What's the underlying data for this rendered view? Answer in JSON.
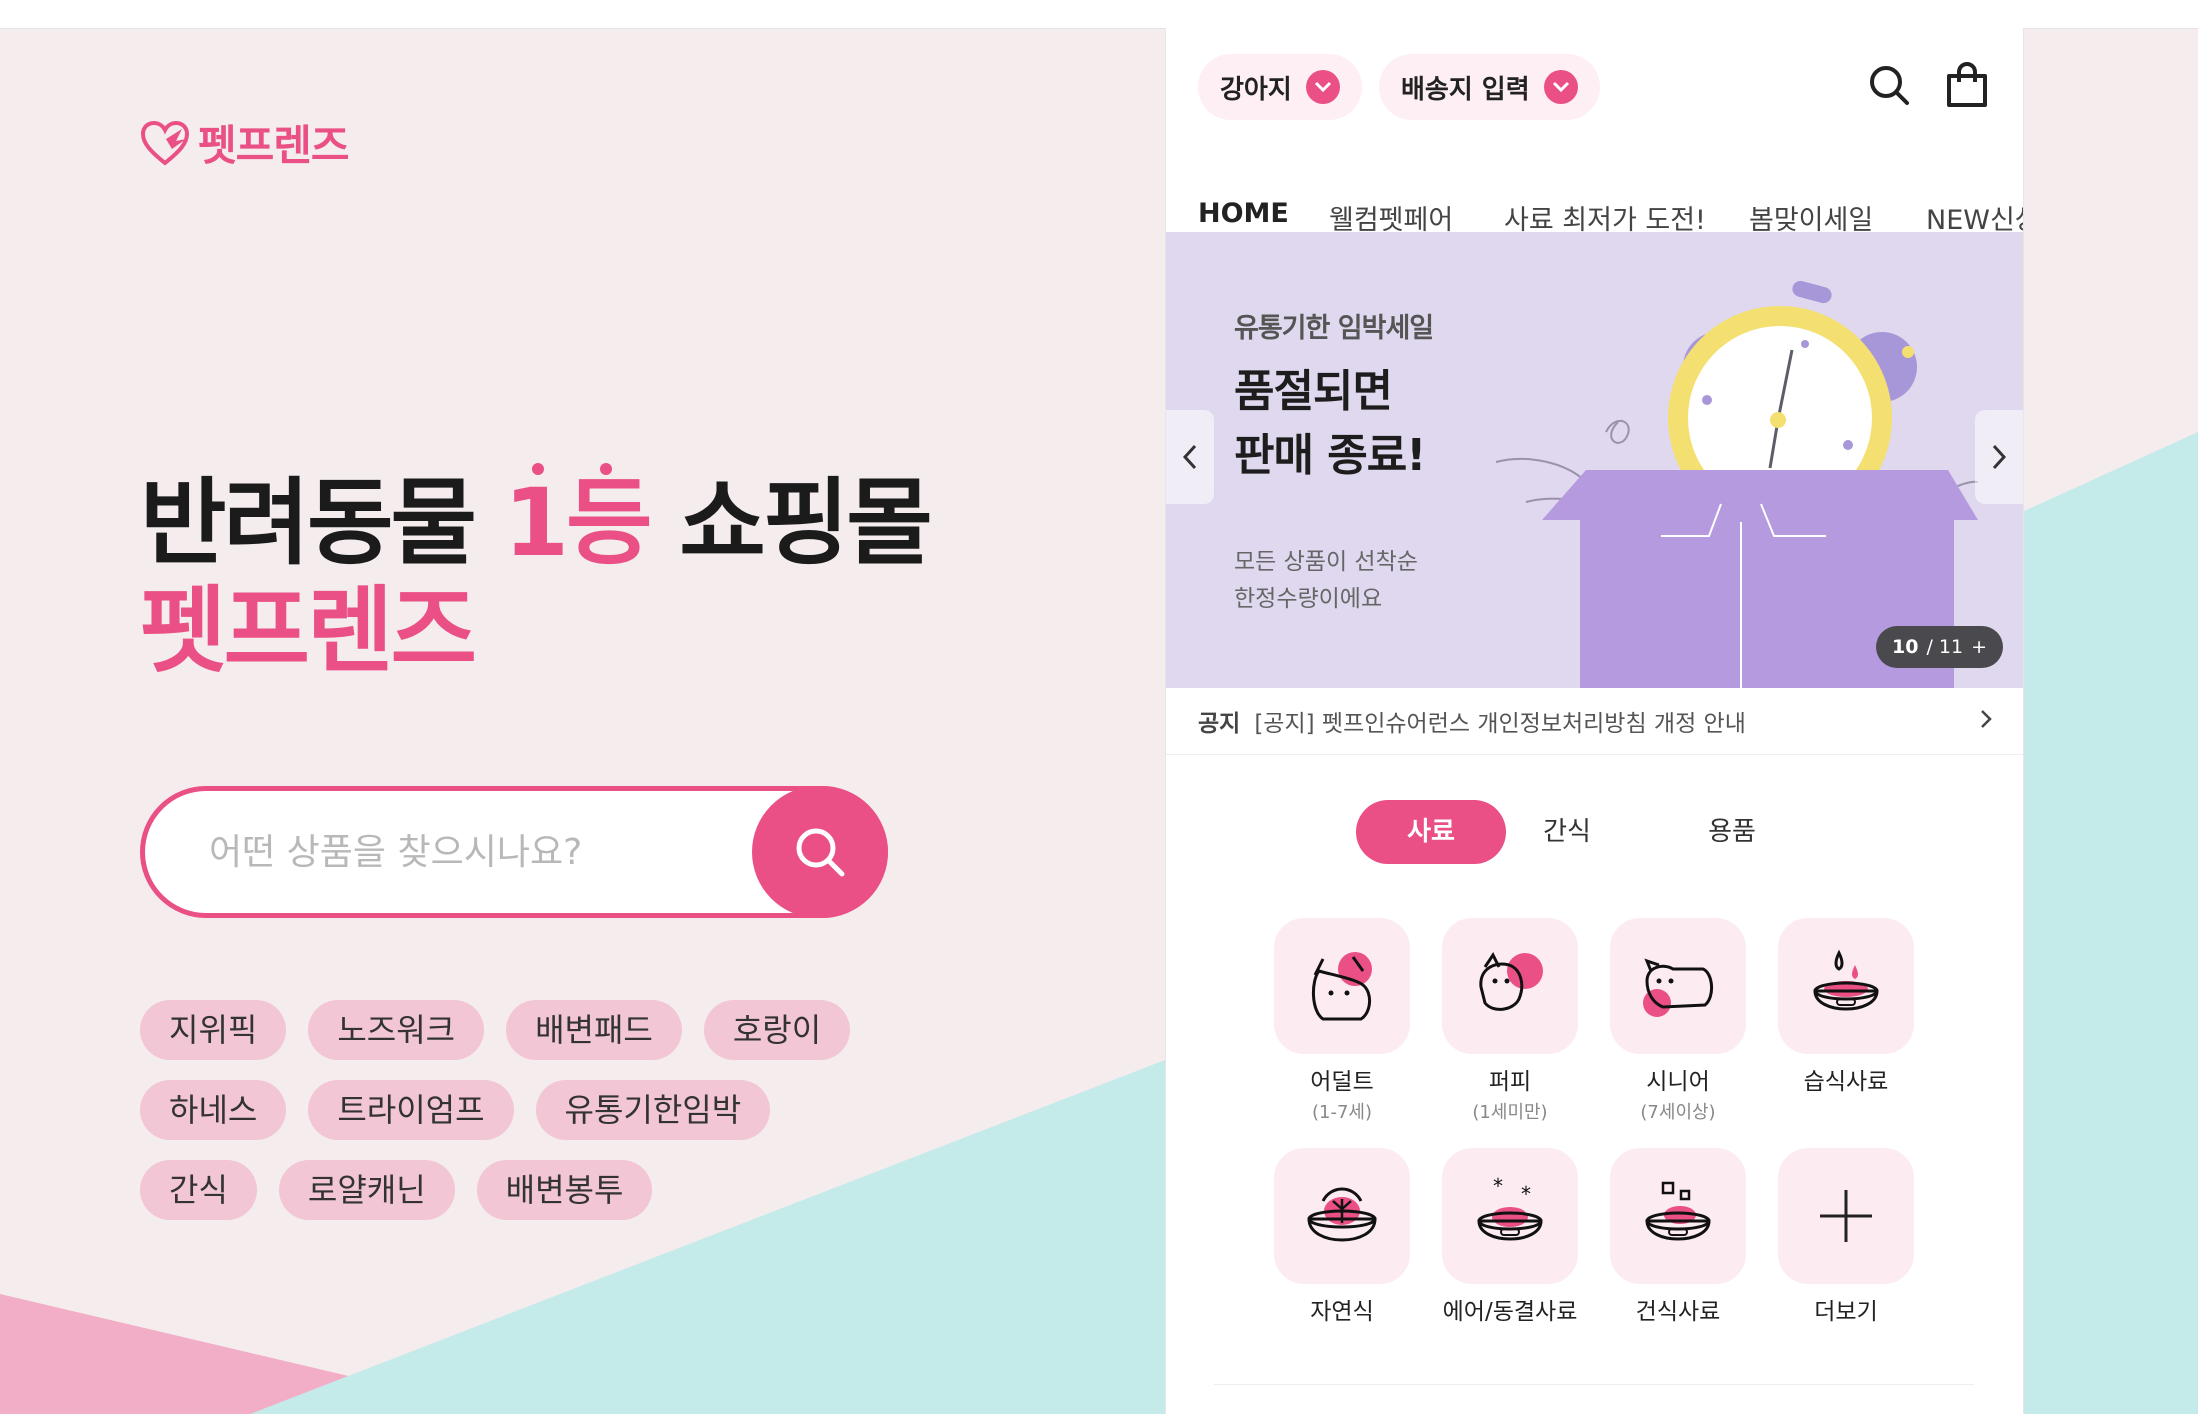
{
  "colors": {
    "brand": "#ea5085",
    "tag_bg": "#f2c6d5",
    "banner_bg": "#e0d8ee",
    "mint": "#c4eaea",
    "pink_bg": "#f4eced"
  },
  "logo": {
    "text": "펫프렌즈",
    "icon": "heart-wing-logo-icon"
  },
  "hero": {
    "line1_pre": "반려동물 ",
    "line1_accent": "1등",
    "line1_post": " 쇼핑몰",
    "line2": "펫프렌즈"
  },
  "search": {
    "placeholder": "어떤 상품을 찾으시나요?",
    "icon": "search-icon"
  },
  "tags": [
    [
      "지위픽",
      "노즈워크",
      "배변패드",
      "호랑이"
    ],
    [
      "하네스",
      "트라이엄프",
      "유통기한임박"
    ],
    [
      "간식",
      "로얄캐닌",
      "배변봉투"
    ]
  ],
  "phone": {
    "pet_select": "강아지",
    "address_select": "배송지 입력",
    "tabs": [
      "HOME",
      "웰컴펫페어",
      "사료 최저가 도전!",
      "봄맞이세일",
      "NEW신상"
    ],
    "banner": {
      "subtitle": "유통기한 임박세일",
      "title_line1": "품절되면",
      "title_line2": "판매 종료!",
      "desc_line1": "모든 상품이 선착순",
      "desc_line2": "한정수량이에요",
      "counter_current": "10",
      "counter_sep": "/ 11",
      "counter_plus": "+"
    },
    "notice": {
      "label": "공지",
      "text": "[공지] 펫프인슈어런스 개인정보처리방침 개정 안내"
    },
    "segments": [
      "사료",
      "간식",
      "용품"
    ],
    "categories": [
      {
        "label": "어덜트",
        "sub": "(1-7세)",
        "icon": "adult-dog-icon"
      },
      {
        "label": "퍼피",
        "sub": "(1세미만)",
        "icon": "puppy-icon"
      },
      {
        "label": "시니어",
        "sub": "(7세이상)",
        "icon": "senior-dog-icon"
      },
      {
        "label": "습식사료",
        "sub": "",
        "icon": "wet-food-bowl-icon"
      },
      {
        "label": "자연식",
        "sub": "",
        "icon": "natural-food-icon"
      },
      {
        "label": "에어/동결사료",
        "sub": "",
        "icon": "freeze-dried-bowl-icon"
      },
      {
        "label": "건식사료",
        "sub": "",
        "icon": "dry-food-bowl-icon"
      },
      {
        "label": "더보기",
        "sub": "",
        "icon": "plus-icon"
      }
    ]
  }
}
